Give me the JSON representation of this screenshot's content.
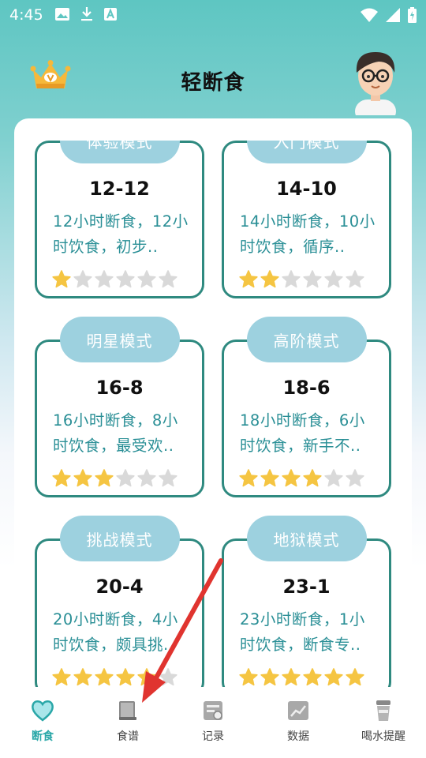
{
  "status_bar": {
    "time": "4:45"
  },
  "header": {
    "title": "轻断食"
  },
  "plans": [
    {
      "mode": "体验模式",
      "ratio": "12-12",
      "desc": "12小时断食，12小时饮食，初步..",
      "stars_filled": 1,
      "stars_total": 6
    },
    {
      "mode": "入门模式",
      "ratio": "14-10",
      "desc": "14小时断食，10小时饮食，循序..",
      "stars_filled": 2,
      "stars_total": 6
    },
    {
      "mode": "明星模式",
      "ratio": "16-8",
      "desc": "16小时断食，8小时饮食，最受欢..",
      "stars_filled": 3,
      "stars_total": 6
    },
    {
      "mode": "高阶模式",
      "ratio": "18-6",
      "desc": "18小时断食，6小时饮食，新手不..",
      "stars_filled": 4,
      "stars_total": 6
    },
    {
      "mode": "挑战模式",
      "ratio": "20-4",
      "desc": "20小时断食，4小时饮食，颇具挑..",
      "stars_filled": 5,
      "stars_total": 6
    },
    {
      "mode": "地狱模式",
      "ratio": "23-1",
      "desc": "23小时断食，1小时饮食，断食专..",
      "stars_filled": 6,
      "stars_total": 6
    }
  ],
  "nav": [
    {
      "label": "断食",
      "icon": "heart-icon",
      "active": true
    },
    {
      "label": "食谱",
      "icon": "book-icon",
      "active": false
    },
    {
      "label": "记录",
      "icon": "record-icon",
      "active": false
    },
    {
      "label": "数据",
      "icon": "chart-icon",
      "active": false
    },
    {
      "label": "喝水提醒",
      "icon": "cup-icon",
      "active": false
    }
  ],
  "colors": {
    "accent": "#2aa7a8",
    "card_border": "#2f8a80",
    "pill": "#9dd1df",
    "desc_text": "#2a8f96",
    "star_on": "#f5c542",
    "star_off": "#d9d9d9",
    "arrow": "#e0342f"
  }
}
